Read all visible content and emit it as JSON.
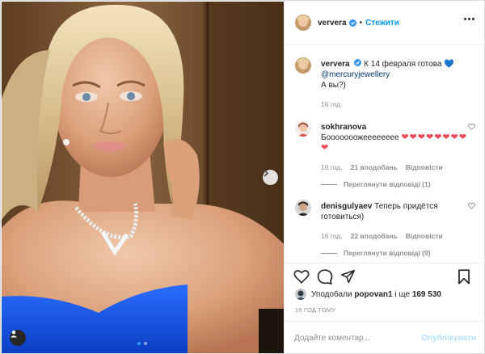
{
  "post": {
    "author": "ververa",
    "follow_label": "Стежити",
    "separator": "•",
    "carousel": {
      "slide_count": 2,
      "active_slide": 1
    }
  },
  "caption": {
    "username": "ververa",
    "text_1": "К 14 февраля готова",
    "heart": "💙",
    "mention": "@mercuryjewellery",
    "text_2": "А вы?)",
    "time": "16 год."
  },
  "comments": [
    {
      "username": "sokhranova",
      "text": "Бооооооожееееееее",
      "hearts": "❤❤❤❤❤❤❤❤❤",
      "time": "16 год.",
      "likes": "21 вподобань",
      "reply_label": "Відповісти",
      "view_replies": "Переглянути відповіді (1)"
    },
    {
      "username": "denisgulyaev",
      "text": "Теперь придётся готовиться)",
      "time": "16 год.",
      "likes": "22 вподобань",
      "reply_label": "Відповісти",
      "view_replies": "Переглянути відповіді (9)"
    }
  ],
  "likes": {
    "prefix": "Уподобали",
    "user": "popovan1",
    "middle": "і ще",
    "count": "169 530"
  },
  "timestamp": "16 ГОД ТОМУ",
  "comment_box": {
    "placeholder": "Додайте коментар...",
    "publish_label": "Опублікувати"
  },
  "colors": {
    "accent": "#0095f6",
    "publish_disabled": "#b2dffc",
    "heart_red": "#ed4956",
    "dress_blue": "#1554e6"
  }
}
